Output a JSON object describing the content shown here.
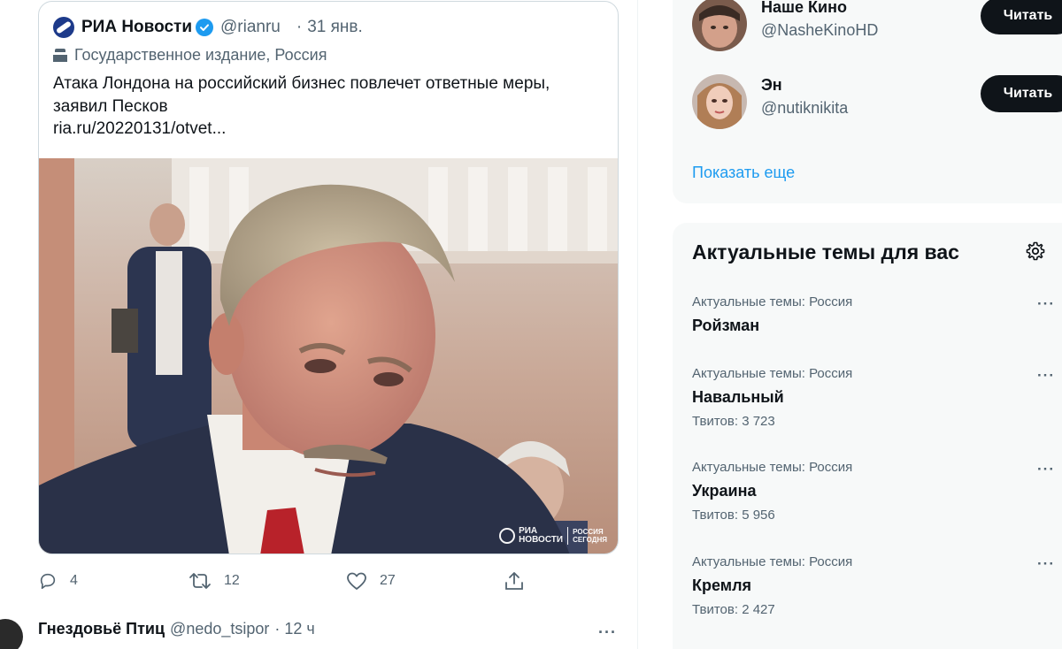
{
  "quoted_tweet": {
    "author_name": "РИА Новости",
    "handle": "@rianru",
    "dot": "·",
    "date": "31 янв.",
    "affiliation": "Государственное издание, Россия",
    "text": "Атака Лондона на российский бизнес повлечет ответные меры, заявил Песков",
    "link": "ria.ru/20220131/otvet...",
    "watermark_left_1": "РИА",
    "watermark_left_2": "НОВОСТИ",
    "watermark_right_1": "РОССИЯ",
    "watermark_right_2": "СЕГОДНЯ"
  },
  "actions": {
    "reply_count": "4",
    "retweet_count": "12",
    "like_count": "27"
  },
  "next_tweet": {
    "author_name": "Гнездовьё Птиц",
    "handle": "@nedo_tsipor",
    "time": "· 12 ч",
    "more": "···"
  },
  "who_to_follow": {
    "users": [
      {
        "name": "Наше Кино",
        "handle": "@NasheKinoHD",
        "button": "Читать"
      },
      {
        "name": "Эн",
        "handle": "@nutiknikita",
        "button": "Читать"
      }
    ],
    "show_more": "Показать еще"
  },
  "trends": {
    "title": "Актуальные темы для вас",
    "more": "···",
    "items": [
      {
        "category": "Актуальные темы: Россия",
        "name": "Ройзман",
        "count": ""
      },
      {
        "category": "Актуальные темы: Россия",
        "name": "Навальный",
        "count": "Твитов: 3 723"
      },
      {
        "category": "Актуальные темы: Россия",
        "name": "Украина",
        "count": "Твитов: 5 956"
      },
      {
        "category": "Актуальные темы: Россия",
        "name": "Кремля",
        "count": "Твитов: 2 427"
      }
    ]
  },
  "colors": {
    "accent": "#1d9bf0",
    "panel_bg": "#f7f9f9",
    "secondary_text": "#536471",
    "button_bg": "#0f1419"
  }
}
